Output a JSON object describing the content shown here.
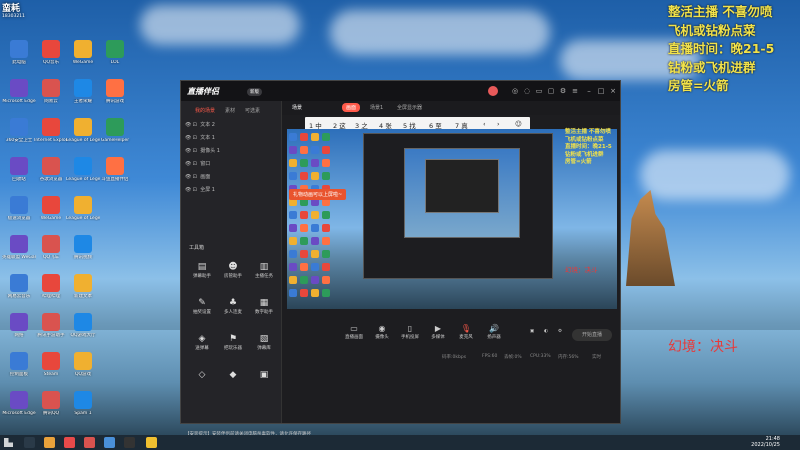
{
  "top_left": {
    "label": "蛮耗",
    "sub": "18303211"
  },
  "desktop_icons": [
    "此电脑",
    "QQ音乐",
    "WeGame",
    "LOL",
    "Microsoft Edge",
    "网易云",
    "王者荣耀",
    "腾讯游戏",
    "360安全卫士",
    "Internet Explorer",
    "League of Legends",
    "GameHelper",
    "回收站",
    "谷歌浏览器",
    "League of Legends",
    "斗鱼直播伴侣",
    "极速浏览器",
    "WeGame",
    "League of Legends",
    "",
    "英雄联盟 WeGame版",
    "QQ飞车",
    "腾讯视频",
    "",
    "网易云音乐",
    "哔哩哔哩",
    "新建文本",
    "",
    "网络",
    "腾讯手游助手",
    "QQ游戏大厅",
    "",
    "控制面板",
    "Steam",
    "QQ游戏",
    "",
    "Microsoft Edge",
    "腾讯QQ",
    "Spam 1",
    ""
  ],
  "overlay": {
    "lines": [
      "整活主播 不喜勿喷",
      "飞机或钻粉点菜",
      "直播时间：晚21-5",
      "钻粉或飞机进群",
      "房管=火箭"
    ],
    "dual": "幻境：决斗"
  },
  "app": {
    "title": "直播伴侣",
    "version": "新版",
    "tabs": [
      "我的场景",
      "素材",
      "可选素"
    ],
    "scenes": [
      "文本 2",
      "文本 1",
      "摄像头 1",
      "窗口",
      "画面",
      "全屏 1"
    ],
    "tools_title": "工具箱",
    "tools": [
      "弹幕助手",
      "房管助手",
      "主播任务",
      "抽奖设置",
      "多人连麦",
      "数字助手",
      "送弹幕",
      "把玩乐器",
      "弹幕库",
      "",
      "",
      ""
    ],
    "scene_tab": "场景1",
    "mid_tabs": [
      "场景",
      "画面",
      "场景1",
      "全屏显示器"
    ],
    "ime": [
      "1 中",
      "2 这",
      "3 之",
      "4 张",
      "5 找",
      "6 至",
      "7 真"
    ],
    "tip": "礼物动画可以上屏啦~",
    "controls": [
      "直播画面",
      "摄像头",
      "手机投屏",
      "多媒体",
      "麦克风",
      "扬声器"
    ],
    "start_label": "开始直播",
    "status": [
      "码率:0kbps",
      "FPS:60",
      "丢帧:0%",
      "CPU:33%",
      "内存:56%",
      "实时"
    ],
    "notice": "【安装提示】安装伴侣前请关闭电脑杀毒软件，请允许保存路径"
  },
  "taskbar": {
    "time": "21:48",
    "date": "2022/10/25"
  },
  "colors": {
    "accent": "#ff5a4a",
    "overlay": "#f2e24a",
    "dual": "#e73a3a"
  }
}
